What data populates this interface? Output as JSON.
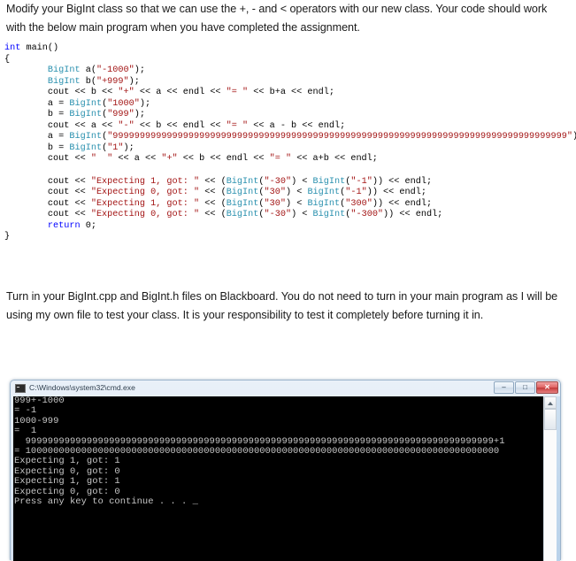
{
  "document": {
    "intro_paragraph": "Modify your BigInt class so that we can use the +, - and < operators with our new class.  Your code should work with the below main program when you have completed the assignment.",
    "turnin_paragraph": "Turn in your BigInt.cpp and BigInt.h files on Blackboard.  You do not need to turn in your main program as I will be using my own file to test your class.  It is your responsibility to test it completely before turning it in."
  },
  "code": {
    "language": "cpp",
    "colors": {
      "keyword": "#0000ff",
      "type": "#2b91af",
      "string": "#a31515",
      "plain": "#000000"
    },
    "lines": [
      [
        {
          "t": "int",
          "c": "kw"
        },
        {
          "t": " main()",
          "c": "plain"
        }
      ],
      [
        {
          "t": "{",
          "c": "plain"
        }
      ],
      [
        {
          "t": "        ",
          "c": "plain"
        },
        {
          "t": "BigInt",
          "c": "typ"
        },
        {
          "t": " a(",
          "c": "plain"
        },
        {
          "t": "\"-1000\"",
          "c": "str"
        },
        {
          "t": ");",
          "c": "plain"
        }
      ],
      [
        {
          "t": "        ",
          "c": "plain"
        },
        {
          "t": "BigInt",
          "c": "typ"
        },
        {
          "t": " b(",
          "c": "plain"
        },
        {
          "t": "\"+999\"",
          "c": "str"
        },
        {
          "t": ");",
          "c": "plain"
        }
      ],
      [
        {
          "t": "        cout << b << ",
          "c": "plain"
        },
        {
          "t": "\"+\"",
          "c": "str"
        },
        {
          "t": " << a << endl << ",
          "c": "plain"
        },
        {
          "t": "\"= \"",
          "c": "str"
        },
        {
          "t": " << b+a << endl;",
          "c": "plain"
        }
      ],
      [
        {
          "t": "        a = ",
          "c": "plain"
        },
        {
          "t": "BigInt",
          "c": "typ"
        },
        {
          "t": "(",
          "c": "plain"
        },
        {
          "t": "\"1000\"",
          "c": "str"
        },
        {
          "t": ");",
          "c": "plain"
        }
      ],
      [
        {
          "t": "        b = ",
          "c": "plain"
        },
        {
          "t": "BigInt",
          "c": "typ"
        },
        {
          "t": "(",
          "c": "plain"
        },
        {
          "t": "\"999\"",
          "c": "str"
        },
        {
          "t": ");",
          "c": "plain"
        }
      ],
      [
        {
          "t": "        cout << a << ",
          "c": "plain"
        },
        {
          "t": "\"-\"",
          "c": "str"
        },
        {
          "t": " << b << endl << ",
          "c": "plain"
        },
        {
          "t": "\"= \"",
          "c": "str"
        },
        {
          "t": " << a - b << endl;",
          "c": "plain"
        }
      ],
      [
        {
          "t": "        a = ",
          "c": "plain"
        },
        {
          "t": "BigInt",
          "c": "typ"
        },
        {
          "t": "(",
          "c": "plain"
        },
        {
          "t": "\"999999999999999999999999999999999999999999999999999999999999999999999999999999999999\"",
          "c": "str"
        },
        {
          "t": ");",
          "c": "plain"
        }
      ],
      [
        {
          "t": "        b = ",
          "c": "plain"
        },
        {
          "t": "BigInt",
          "c": "typ"
        },
        {
          "t": "(",
          "c": "plain"
        },
        {
          "t": "\"1\"",
          "c": "str"
        },
        {
          "t": ");",
          "c": "plain"
        }
      ],
      [
        {
          "t": "        cout << ",
          "c": "plain"
        },
        {
          "t": "\"  \"",
          "c": "str"
        },
        {
          "t": " << a << ",
          "c": "plain"
        },
        {
          "t": "\"+\"",
          "c": "str"
        },
        {
          "t": " << b << endl << ",
          "c": "plain"
        },
        {
          "t": "\"= \"",
          "c": "str"
        },
        {
          "t": " << a+b << endl;",
          "c": "plain"
        }
      ],
      [],
      [
        {
          "t": "        cout << ",
          "c": "plain"
        },
        {
          "t": "\"Expecting 1, got: \"",
          "c": "str"
        },
        {
          "t": " << (",
          "c": "plain"
        },
        {
          "t": "BigInt",
          "c": "typ"
        },
        {
          "t": "(",
          "c": "plain"
        },
        {
          "t": "\"-30\"",
          "c": "str"
        },
        {
          "t": ") < ",
          "c": "plain"
        },
        {
          "t": "BigInt",
          "c": "typ"
        },
        {
          "t": "(",
          "c": "plain"
        },
        {
          "t": "\"-1\"",
          "c": "str"
        },
        {
          "t": ")) << endl;",
          "c": "plain"
        }
      ],
      [
        {
          "t": "        cout << ",
          "c": "plain"
        },
        {
          "t": "\"Expecting 0, got: \"",
          "c": "str"
        },
        {
          "t": " << (",
          "c": "plain"
        },
        {
          "t": "BigInt",
          "c": "typ"
        },
        {
          "t": "(",
          "c": "plain"
        },
        {
          "t": "\"30\"",
          "c": "str"
        },
        {
          "t": ") < ",
          "c": "plain"
        },
        {
          "t": "BigInt",
          "c": "typ"
        },
        {
          "t": "(",
          "c": "plain"
        },
        {
          "t": "\"-1\"",
          "c": "str"
        },
        {
          "t": ")) << endl;",
          "c": "plain"
        }
      ],
      [
        {
          "t": "        cout << ",
          "c": "plain"
        },
        {
          "t": "\"Expecting 1, got: \"",
          "c": "str"
        },
        {
          "t": " << (",
          "c": "plain"
        },
        {
          "t": "BigInt",
          "c": "typ"
        },
        {
          "t": "(",
          "c": "plain"
        },
        {
          "t": "\"30\"",
          "c": "str"
        },
        {
          "t": ") < ",
          "c": "plain"
        },
        {
          "t": "BigInt",
          "c": "typ"
        },
        {
          "t": "(",
          "c": "plain"
        },
        {
          "t": "\"300\"",
          "c": "str"
        },
        {
          "t": ")) << endl;",
          "c": "plain"
        }
      ],
      [
        {
          "t": "        cout << ",
          "c": "plain"
        },
        {
          "t": "\"Expecting 0, got: \"",
          "c": "str"
        },
        {
          "t": " << (",
          "c": "plain"
        },
        {
          "t": "BigInt",
          "c": "typ"
        },
        {
          "t": "(",
          "c": "plain"
        },
        {
          "t": "\"-30\"",
          "c": "str"
        },
        {
          "t": ") < ",
          "c": "plain"
        },
        {
          "t": "BigInt",
          "c": "typ"
        },
        {
          "t": "(",
          "c": "plain"
        },
        {
          "t": "\"-300\"",
          "c": "str"
        },
        {
          "t": ")) << endl;",
          "c": "plain"
        }
      ],
      [
        {
          "t": "        ",
          "c": "plain"
        },
        {
          "t": "return",
          "c": "kw"
        },
        {
          "t": " ",
          "c": "plain"
        },
        {
          "t": "0",
          "c": "plain"
        },
        {
          "t": ";",
          "c": "plain"
        }
      ],
      [
        {
          "t": "}",
          "c": "plain"
        }
      ]
    ]
  },
  "console": {
    "title": "C:\\Windows\\system32\\cmd.exe",
    "icon": "cmd-icon",
    "window_buttons": {
      "minimize": "–",
      "maximize": "□",
      "close": "✕"
    },
    "output_lines": [
      "999+-1000",
      "= -1",
      "1000-999",
      "=  1",
      "  999999999999999999999999999999999999999999999999999999999999999999999999999999999999+1",
      "= 1000000000000000000000000000000000000000000000000000000000000000000000000000000000000",
      "Expecting 1, got: 1",
      "Expecting 0, got: 0",
      "Expecting 1, got: 1",
      "Expecting 0, got: 0",
      "Press any key to continue . . . _"
    ],
    "background_color": "#000000",
    "text_color": "#c6c6c6"
  }
}
